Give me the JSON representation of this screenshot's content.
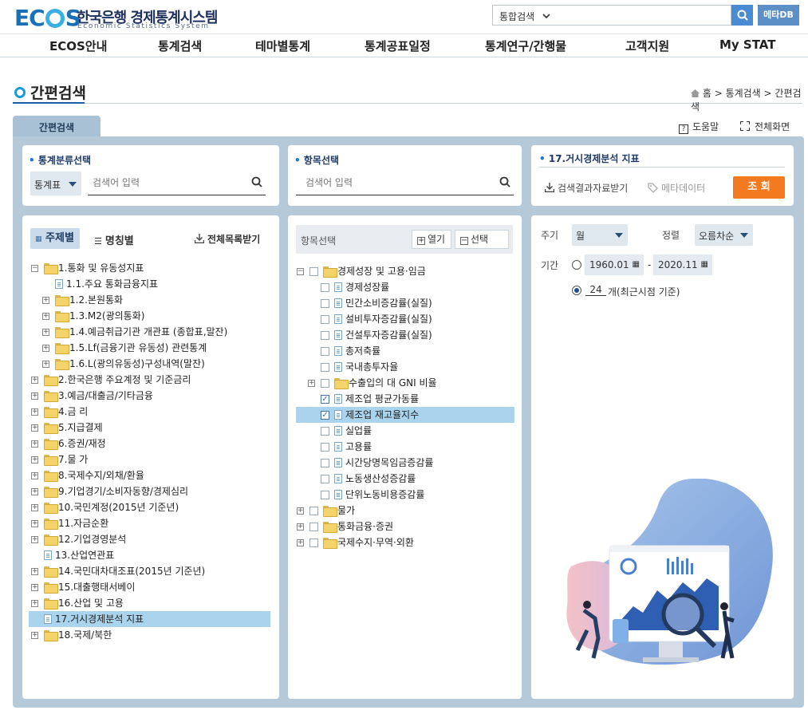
{
  "header": {
    "logo_main": "EC",
    "logo_tail": "S",
    "logo_kr": "한국은행 경제통계시스템",
    "logo_en": "Economic Statistics System",
    "search_select": "통합검색",
    "meta_db": "메타DB"
  },
  "nav": [
    "ECOS안내",
    "통계검색",
    "테마별통계",
    "통계공표일정",
    "통계연구/간행물",
    "고객지원",
    "My STAT"
  ],
  "page": {
    "title": "간편검색",
    "breadcrumb": [
      "홈",
      "통계검색",
      "간편검색"
    ],
    "tab": "간편검색",
    "help": "도움말",
    "fullscreen": "전체화면"
  },
  "panel_category": {
    "title": "통계분류선택",
    "select": "통계표",
    "placeholder": "검색어 입력",
    "tab_subject": "주제별",
    "tab_name": "명칭별",
    "download": "전체목록받기",
    "tree": [
      {
        "label": "1.통화 및 유동성지표",
        "type": "folder",
        "open": true,
        "level": 0
      },
      {
        "label": "1.1.주요 통화금융지표",
        "type": "doc",
        "level": 1
      },
      {
        "label": "1.2.본원통화",
        "type": "folder",
        "level": 1
      },
      {
        "label": "1.3.M2(광의통화)",
        "type": "folder",
        "level": 1
      },
      {
        "label": "1.4.예금취급기관 개관표 (종합표,말잔)",
        "type": "folder",
        "level": 1
      },
      {
        "label": "1.5.Lf(금융기관 유동성) 관련통계",
        "type": "folder",
        "level": 1
      },
      {
        "label": "1.6.L(광의유동성)구성내역(말잔)",
        "type": "folder",
        "level": 1
      },
      {
        "label": "2.한국은행 주요계정 및 기준금리",
        "type": "folder",
        "level": 0
      },
      {
        "label": "3.예금/대출금/기타금융",
        "type": "folder",
        "level": 0
      },
      {
        "label": "4.금 리",
        "type": "folder",
        "level": 0
      },
      {
        "label": "5.지급결제",
        "type": "folder",
        "level": 0
      },
      {
        "label": "6.증권/재정",
        "type": "folder",
        "level": 0
      },
      {
        "label": "7.물 가",
        "type": "folder",
        "level": 0
      },
      {
        "label": "8.국제수지/외채/환율",
        "type": "folder",
        "level": 0
      },
      {
        "label": "9.기업경기/소비자동향/경제심리",
        "type": "folder",
        "level": 0
      },
      {
        "label": "10.국민계정(2015년 기준년)",
        "type": "folder",
        "level": 0
      },
      {
        "label": "11.자금순환",
        "type": "folder",
        "level": 0
      },
      {
        "label": "12.기업경영분석",
        "type": "folder",
        "level": 0
      },
      {
        "label": "13.산업연관표",
        "type": "doc",
        "level": 0
      },
      {
        "label": "14.국민대차대조표(2015년 기준년)",
        "type": "folder",
        "level": 0
      },
      {
        "label": "15.대출행태서베이",
        "type": "folder",
        "level": 0
      },
      {
        "label": "16.산업 및 고용",
        "type": "folder",
        "level": 0
      },
      {
        "label": "17.거시경제분석 지표",
        "type": "doc",
        "level": 0,
        "selected": true
      },
      {
        "label": "18.국제/북한",
        "type": "folder",
        "level": 0
      }
    ]
  },
  "panel_items": {
    "title": "항목선택",
    "placeholder": "검색어 입력",
    "toolbar_label": "항목선택",
    "open_label": "열기",
    "select_label": "선택",
    "tree": [
      {
        "label": "경제성장 및 고용·임금",
        "type": "folder",
        "open": true,
        "level": 0,
        "checked": false
      },
      {
        "label": "경제성장률",
        "type": "doc",
        "level": 1,
        "checked": false
      },
      {
        "label": "민간소비증감률(실질)",
        "type": "doc",
        "level": 1,
        "checked": false
      },
      {
        "label": "설비투자증감률(실질)",
        "type": "doc",
        "level": 1,
        "checked": false
      },
      {
        "label": "건설투자증감률(실질)",
        "type": "doc",
        "level": 1,
        "checked": false
      },
      {
        "label": "총저축률",
        "type": "doc",
        "level": 1,
        "checked": false
      },
      {
        "label": "국내총투자율",
        "type": "doc",
        "level": 1,
        "checked": false
      },
      {
        "label": "수출입의 대 GNI 비율",
        "type": "folder",
        "level": 1,
        "checked": false
      },
      {
        "label": "제조업 평균가동률",
        "type": "doc",
        "level": 1,
        "checked": true
      },
      {
        "label": "제조업 재고율지수",
        "type": "doc",
        "level": 1,
        "checked": true,
        "selected": true
      },
      {
        "label": "실업률",
        "type": "doc",
        "level": 1,
        "checked": false
      },
      {
        "label": "고용률",
        "type": "doc",
        "level": 1,
        "checked": false
      },
      {
        "label": "시간당명목임금증감률",
        "type": "doc",
        "level": 1,
        "checked": false
      },
      {
        "label": "노동생산성증감률",
        "type": "doc",
        "level": 1,
        "checked": false
      },
      {
        "label": "단위노동비용증감률",
        "type": "doc",
        "level": 1,
        "checked": false
      },
      {
        "label": "물가",
        "type": "folder",
        "level": 0,
        "checked": false
      },
      {
        "label": "통화금융·증권",
        "type": "folder",
        "level": 0,
        "checked": false
      },
      {
        "label": "국제수지·무역·외환",
        "type": "folder",
        "level": 0,
        "checked": false
      }
    ]
  },
  "panel_result": {
    "title": "17.거시경제분석 지표",
    "download": "검색결과자료받기",
    "metadata": "메타데이터",
    "search_button": "조 회",
    "cycle_label": "주기",
    "cycle_value": "월",
    "sort_label": "정렬",
    "sort_value": "오름차순",
    "period_label": "기간",
    "date_from": "1960.01",
    "date_sep": "-",
    "date_to": "2020.11",
    "count_value": "24",
    "count_suffix": "개(최근시점 기준)"
  },
  "colors": {
    "accent": "#1a6fb6",
    "orange": "#f47a1f",
    "canvas": "#b5c9d9",
    "highlight": "#aad4ee"
  },
  "icons": [
    "search-icon",
    "chevron-down-icon",
    "help-icon",
    "fullscreen-icon",
    "download-icon",
    "tag-icon",
    "calendar-icon",
    "folder-icon",
    "document-icon",
    "checkbox-icon",
    "home-icon",
    "list-icon",
    "grid-icon"
  ]
}
